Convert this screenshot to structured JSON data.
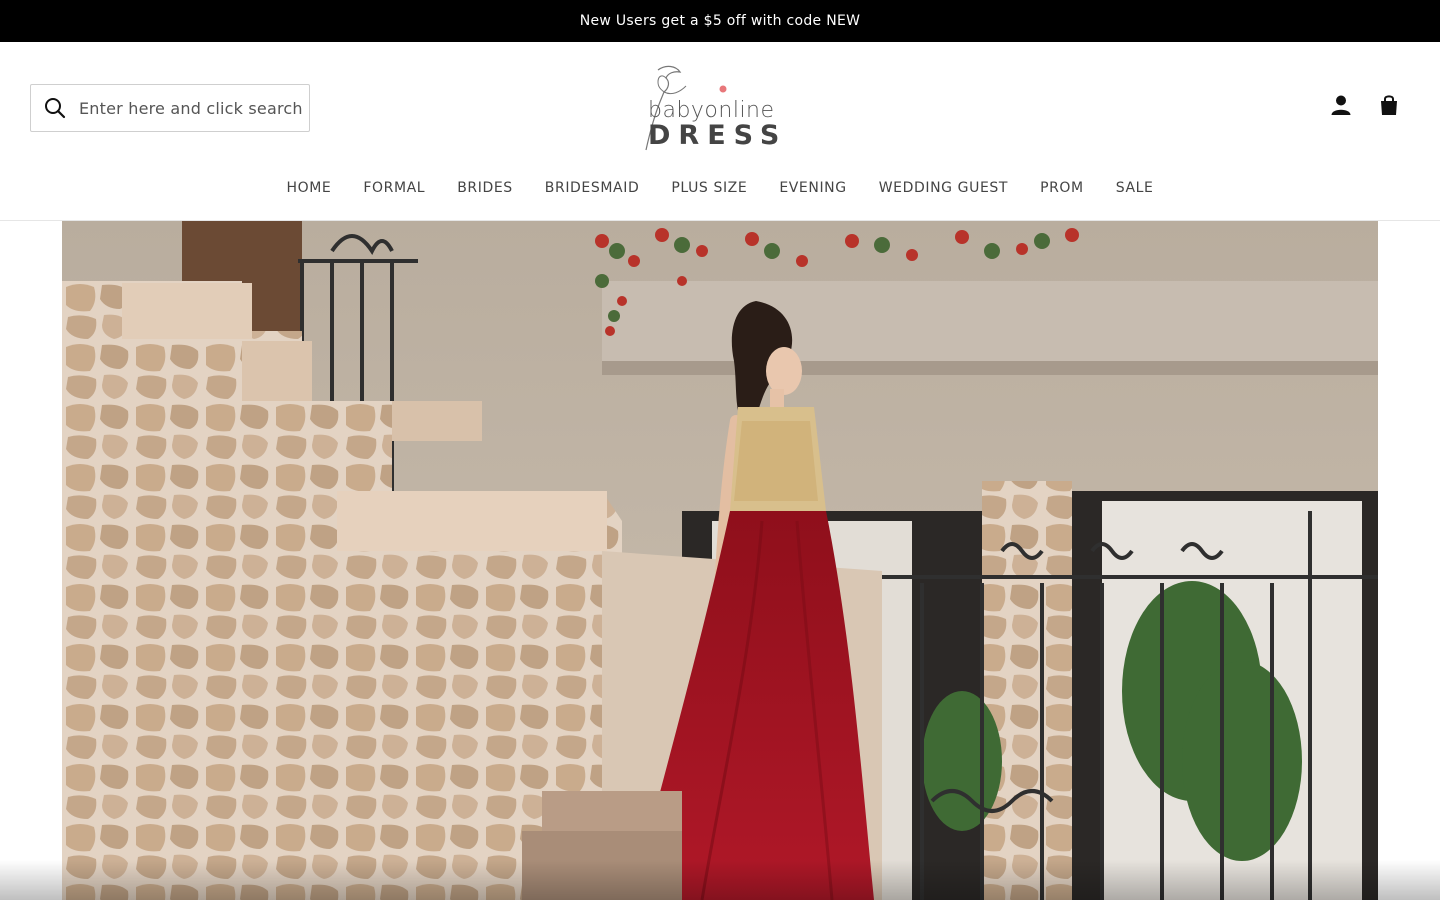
{
  "announcement": {
    "text": "New Users get a $5 off with code NEW"
  },
  "search": {
    "placeholder": "Enter here and click search",
    "icon": "search-icon"
  },
  "logo": {
    "top": "babyonline",
    "bottom": "DRESS",
    "accent": "#e8777a"
  },
  "header_icons": {
    "account": "user-icon",
    "cart": "shopping-bag-icon"
  },
  "nav": {
    "items": [
      {
        "label": "HOME"
      },
      {
        "label": "FORMAL"
      },
      {
        "label": "BRIDES"
      },
      {
        "label": "BRIDESMAID"
      },
      {
        "label": "PLUS SIZE"
      },
      {
        "label": "EVENING"
      },
      {
        "label": "WEDDING GUEST"
      },
      {
        "label": "PROM"
      },
      {
        "label": "SALE"
      }
    ]
  },
  "colors": {
    "announcement_bg": "#000000",
    "dress_red": "#a0141f",
    "bodice_gold": "#d8bf8c",
    "stone": "#c9b7a3"
  }
}
